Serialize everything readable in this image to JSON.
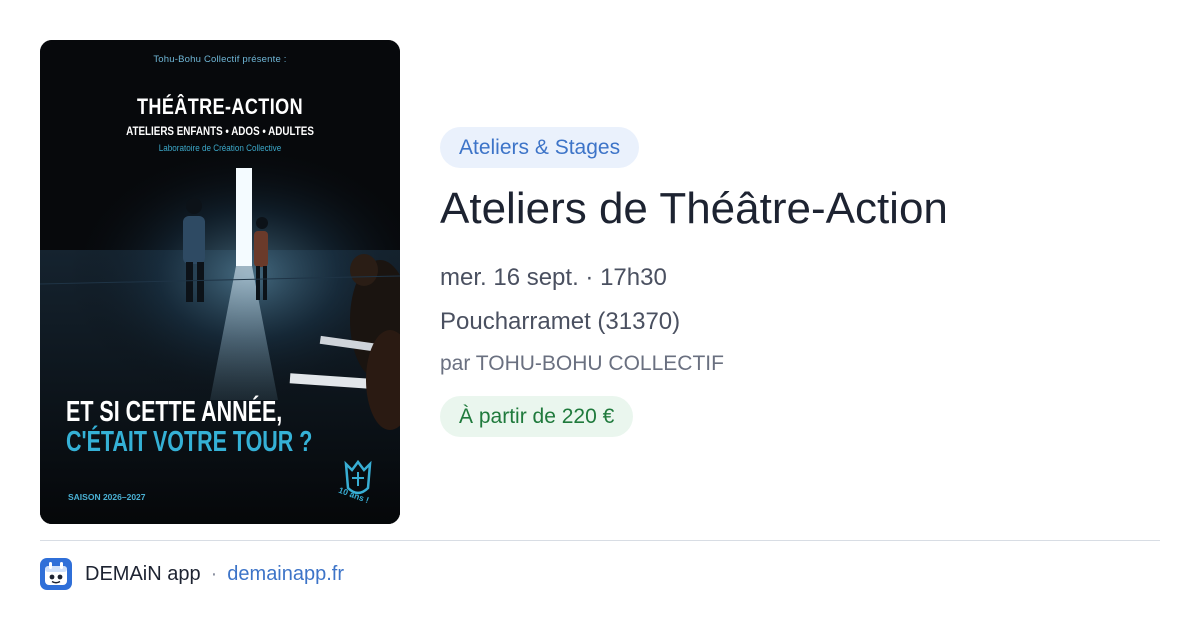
{
  "poster": {
    "presents": "Tohu-Bohu Collectif présente :",
    "title": "THÉÂTRE-ACTION",
    "subtitle": "ATELIERS ENFANTS • ADOS • ADULTES",
    "lab": "Laboratoire de Création Collective",
    "headline_line1": "ET SI CETTE ANNÉE,",
    "headline_line2": "C'ÉTAIT VOTRE TOUR ?",
    "season": "SAISON 2026–2027",
    "badge": "10 ans !"
  },
  "event": {
    "category": "Ateliers & Stages",
    "title": "Ateliers de Théâtre-Action",
    "date": "mer. 16 sept. · 17h30",
    "location": "Poucharramet (31370)",
    "organizer": "par TOHU-BOHU COLLECTIF",
    "price": "À partir de 220 €"
  },
  "footer": {
    "app_name": "DEMAiN app",
    "separator": "·",
    "domain": "demainapp.fr"
  },
  "colors": {
    "accent_blue": "#3d74c8",
    "category_bg": "#eaf1fc",
    "price_green": "#1f7a3c",
    "price_bg": "#eaf6ee",
    "poster_cyan": "#35b1d6"
  },
  "icons": {
    "app": "demain-app-icon"
  }
}
